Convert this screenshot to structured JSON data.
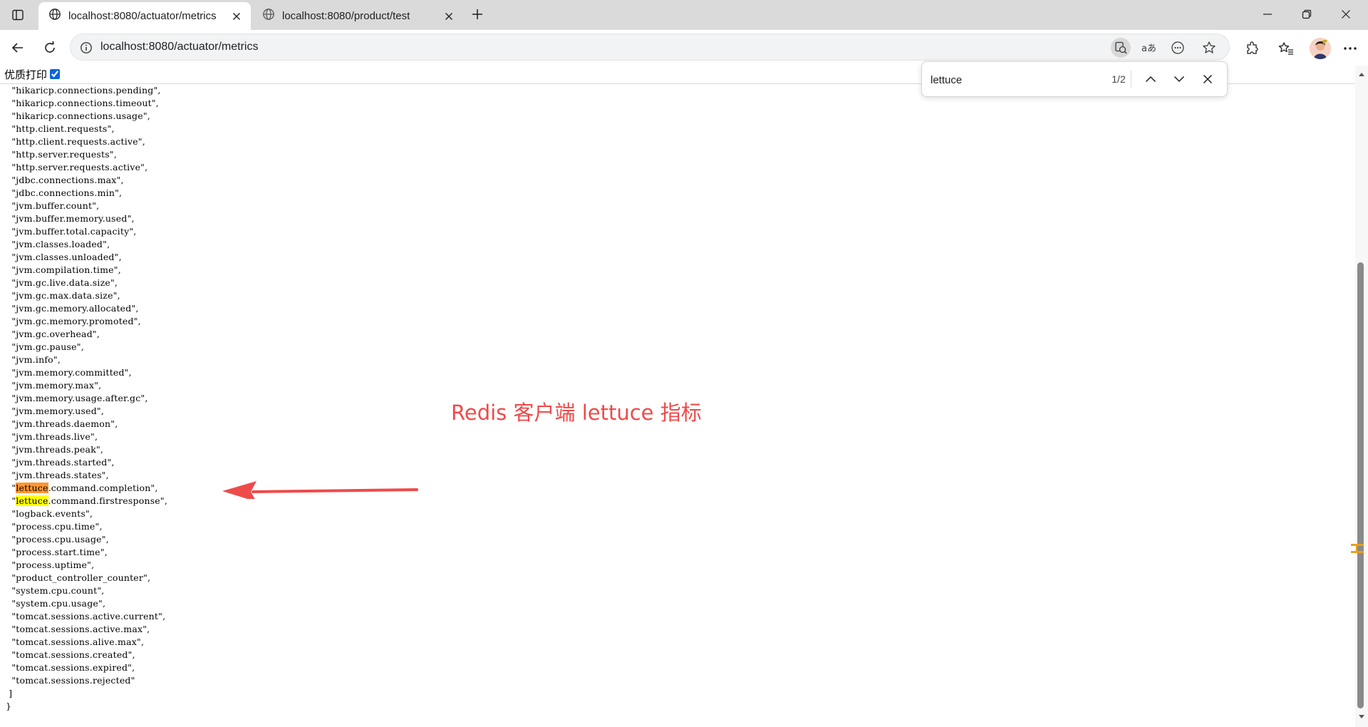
{
  "tabs": [
    {
      "title": "localhost:8080/actuator/metrics",
      "active": true
    },
    {
      "title": "localhost:8080/product/test",
      "active": false
    }
  ],
  "address": {
    "url": "localhost:8080/actuator/metrics"
  },
  "page": {
    "print_label": "优质打印",
    "print_checked": true,
    "lines": [
      "\"hikaricp.connections.pending\",",
      "\"hikaricp.connections.timeout\",",
      "\"hikaricp.connections.usage\",",
      "\"http.client.requests\",",
      "\"http.client.requests.active\",",
      "\"http.server.requests\",",
      "\"http.server.requests.active\",",
      "\"jdbc.connections.max\",",
      "\"jdbc.connections.min\",",
      "\"jvm.buffer.count\",",
      "\"jvm.buffer.memory.used\",",
      "\"jvm.buffer.total.capacity\",",
      "\"jvm.classes.loaded\",",
      "\"jvm.classes.unloaded\",",
      "\"jvm.compilation.time\",",
      "\"jvm.gc.live.data.size\",",
      "\"jvm.gc.max.data.size\",",
      "\"jvm.gc.memory.allocated\",",
      "\"jvm.gc.memory.promoted\",",
      "\"jvm.gc.overhead\",",
      "\"jvm.gc.pause\",",
      "\"jvm.info\",",
      "\"jvm.memory.committed\",",
      "\"jvm.memory.max\",",
      "\"jvm.memory.usage.after.gc\",",
      "\"jvm.memory.used\",",
      "\"jvm.threads.daemon\",",
      "\"jvm.threads.live\",",
      "\"jvm.threads.peak\",",
      "\"jvm.threads.started\",",
      "\"jvm.threads.states\",",
      "\"lettuce.command.completion\",",
      "\"lettuce.command.firstresponse\",",
      "\"logback.events\",",
      "\"process.cpu.time\",",
      "\"process.cpu.usage\",",
      "\"process.start.time\",",
      "\"process.uptime\",",
      "\"product_controller_counter\",",
      "\"system.cpu.count\",",
      "\"system.cpu.usage\",",
      "\"tomcat.sessions.active.current\",",
      "\"tomcat.sessions.active.max\",",
      "\"tomcat.sessions.alive.max\",",
      "\"tomcat.sessions.created\",",
      "\"tomcat.sessions.expired\",",
      "\"tomcat.sessions.rejected\""
    ],
    "closing_bracket": "]",
    "closing_brace": "}"
  },
  "annotation": {
    "text": "Redis 客户端 lettuce 指标",
    "color": "#ef4a4a"
  },
  "find": {
    "query": "lettuce",
    "count": "1/2",
    "current_highlight": "#ff9632",
    "other_highlight": "#ffff00"
  }
}
